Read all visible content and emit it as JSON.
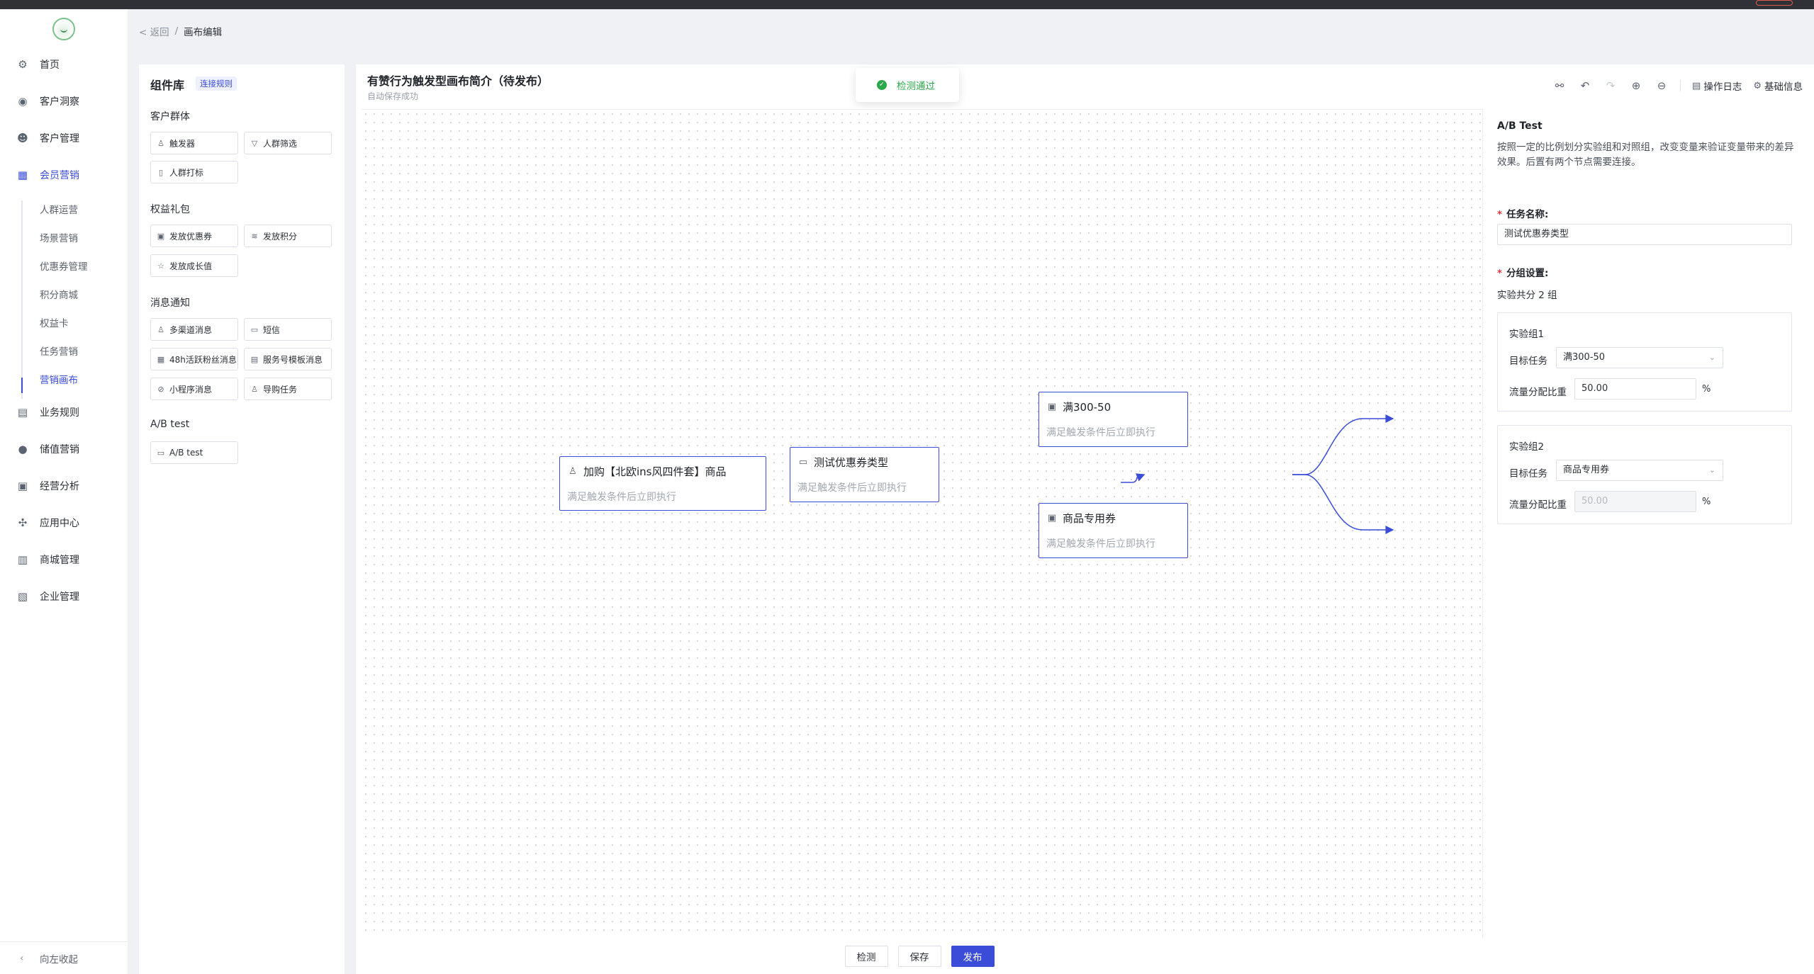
{
  "sidebar": {
    "items": [
      {
        "label": "首页",
        "icon": "dashboard-icon",
        "glyph": "⚙"
      },
      {
        "label": "客户洞察",
        "icon": "eye-icon",
        "glyph": "◉"
      },
      {
        "label": "客户管理",
        "icon": "user-icon",
        "glyph": "☻"
      },
      {
        "label": "会员营销",
        "icon": "gift-icon",
        "glyph": "▦",
        "active": true
      },
      {
        "label": "业务规则",
        "icon": "document-icon",
        "glyph": "▤"
      },
      {
        "label": "储值营销",
        "icon": "coin-icon",
        "glyph": "●"
      },
      {
        "label": "经营分析",
        "icon": "clipboard-icon",
        "glyph": "▣"
      },
      {
        "label": "应用中心",
        "icon": "apps-icon",
        "glyph": "✣"
      },
      {
        "label": "商城管理",
        "icon": "store-icon",
        "glyph": "▥"
      },
      {
        "label": "企业管理",
        "icon": "building-icon",
        "glyph": "▧"
      }
    ],
    "sub_items": [
      "人群运营",
      "场景营销",
      "优惠券管理",
      "积分商城",
      "权益卡",
      "任务营销",
      "营销画布"
    ],
    "collapse_label": "向左收起"
  },
  "breadcrumb": {
    "back": "< 返回",
    "separator": "/",
    "current": "画布编辑"
  },
  "library": {
    "title": "组件库",
    "rule_link": "连接规则",
    "sections": [
      {
        "title": "客户群体",
        "items": [
          {
            "label": "触发器",
            "icon": "user-outline-icon",
            "glyph": "♙"
          },
          {
            "label": "人群筛选",
            "icon": "filter-icon",
            "glyph": "▽"
          },
          {
            "label": "人群打标",
            "icon": "tag-icon",
            "glyph": "▯"
          }
        ]
      },
      {
        "title": "权益礼包",
        "items": [
          {
            "label": "发放优惠券",
            "icon": "coupon-icon",
            "glyph": "▣"
          },
          {
            "label": "发放积分",
            "icon": "stack-icon",
            "glyph": "≋"
          },
          {
            "label": "发放成长值",
            "icon": "star-icon",
            "glyph": "☆"
          }
        ]
      },
      {
        "title": "消息通知",
        "items": [
          {
            "label": "多渠道消息",
            "icon": "users-icon",
            "glyph": "♙"
          },
          {
            "label": "短信",
            "icon": "chat-icon",
            "glyph": "▭"
          },
          {
            "label": "48h活跃粉丝消息",
            "icon": "calendar-icon",
            "glyph": "▦"
          },
          {
            "label": "服务号模板消息",
            "icon": "template-icon",
            "glyph": "▤"
          },
          {
            "label": "小程序消息",
            "icon": "miniapp-icon",
            "glyph": "⊘"
          },
          {
            "label": "导购任务",
            "icon": "guide-icon",
            "glyph": "♙"
          }
        ]
      },
      {
        "title": "A/B test",
        "items": [
          {
            "label": "A/B test",
            "icon": "folder-icon",
            "glyph": "▭"
          }
        ]
      }
    ]
  },
  "canvas": {
    "title": "有赞行为触发型画布简介（待发布）",
    "subtitle": "自动保存成功",
    "toast": "检测通过",
    "toolbar": {
      "icons": [
        {
          "name": "share-icon",
          "glyph": "⚯",
          "disabled": false
        },
        {
          "name": "undo-icon",
          "glyph": "↶",
          "disabled": false
        },
        {
          "name": "redo-icon",
          "glyph": "↷",
          "disabled": true
        },
        {
          "name": "zoom-in-icon",
          "glyph": "⊕",
          "disabled": false
        },
        {
          "name": "zoom-out-icon",
          "glyph": "⊖",
          "disabled": false
        }
      ],
      "log_label": "操作日志",
      "info_label": "基础信息"
    },
    "nodes": [
      {
        "title": "加购【北欧ins风四件套】商品",
        "desc": "满足触发条件后立即执行",
        "icon": "user-outline-icon",
        "glyph": "♙"
      },
      {
        "title": "测试优惠券类型",
        "desc": "满足触发条件后立即执行",
        "icon": "folder-icon",
        "glyph": "▭"
      },
      {
        "title": "满300-50",
        "desc": "满足触发条件后立即执行",
        "icon": "coupon-icon",
        "glyph": "▣"
      },
      {
        "title": "商品专用券",
        "desc": "满足触发条件后立即执行",
        "icon": "coupon-icon",
        "glyph": "▣"
      }
    ],
    "actions": {
      "check": "检测",
      "save": "保存",
      "publish": "发布"
    }
  },
  "properties": {
    "title": "A/B Test",
    "description": "按照一定的比例划分实验组和对照组，改变变量来验证变量带来的差异效果。后置有两个节点需要连接。",
    "task_name_label": "任务名称:",
    "task_name_value": "测试优惠券类型",
    "group_label": "分组设置:",
    "group_count_text": "实验共分 2 组",
    "groups": [
      {
        "title": "实验组1",
        "target_label": "目标任务",
        "target_value": "满300-50",
        "ratio_label": "流量分配比重",
        "ratio_value": "50.00",
        "ratio_unit": "%",
        "ratio_disabled": false
      },
      {
        "title": "实验组2",
        "target_label": "目标任务",
        "target_value": "商品专用券",
        "ratio_label": "流量分配比重",
        "ratio_value": "50.00",
        "ratio_unit": "%",
        "ratio_disabled": true
      }
    ]
  },
  "colors": {
    "accent": "#3a4cd8",
    "success": "#2ba84a",
    "required": "#e0393e"
  }
}
